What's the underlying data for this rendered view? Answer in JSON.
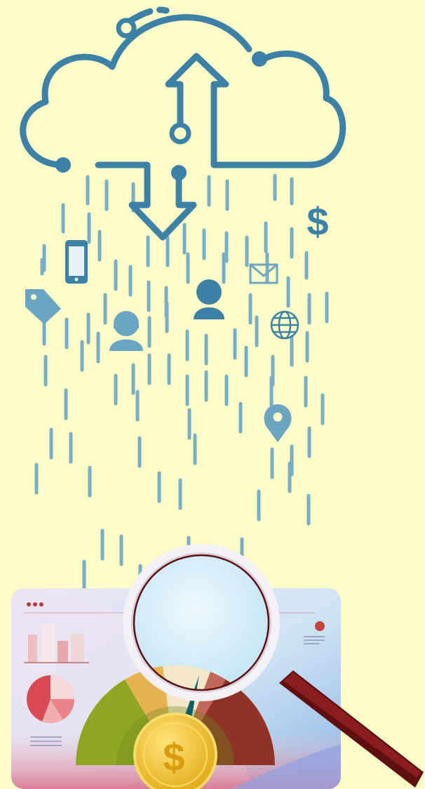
{
  "illustration": {
    "theme": "cloud data flow to analytics dashboard with magnifier and currency gauge",
    "icons": [
      "cloud-icon",
      "upload-arrow-icon",
      "download-arrow-icon",
      "dollar-sign-icon",
      "smartphone-icon",
      "price-tag-icon",
      "user-male-icon",
      "user-female-icon",
      "mail-icon",
      "globe-icon",
      "map-pin-icon",
      "bar-chart-icon",
      "pie-chart-icon",
      "magnifier-icon",
      "gauge-icon",
      "coin-icon"
    ]
  },
  "glyphs": {
    "dollar": "$",
    "coin": "$"
  },
  "colors": {
    "background": "#fdfcc8",
    "line_primary": "#3d82a6",
    "line_muted": "#79aec6",
    "dashboard_top": "#e2f1fb",
    "dashboard_bottom": "#bcd7ef",
    "bar_light": "#f6e6e6",
    "bar_dark": "#e29a98",
    "pie_red": "#d94a55",
    "gauge_green": "#8fa625",
    "gauge_gold": "#e7b352",
    "gauge_cream": "#f5e7c9",
    "gauge_red": "#8e3325",
    "coin": "#f3c52a",
    "magnifier_rim": "#f3f0f6",
    "magnifier_handle": "#5e0f10"
  }
}
